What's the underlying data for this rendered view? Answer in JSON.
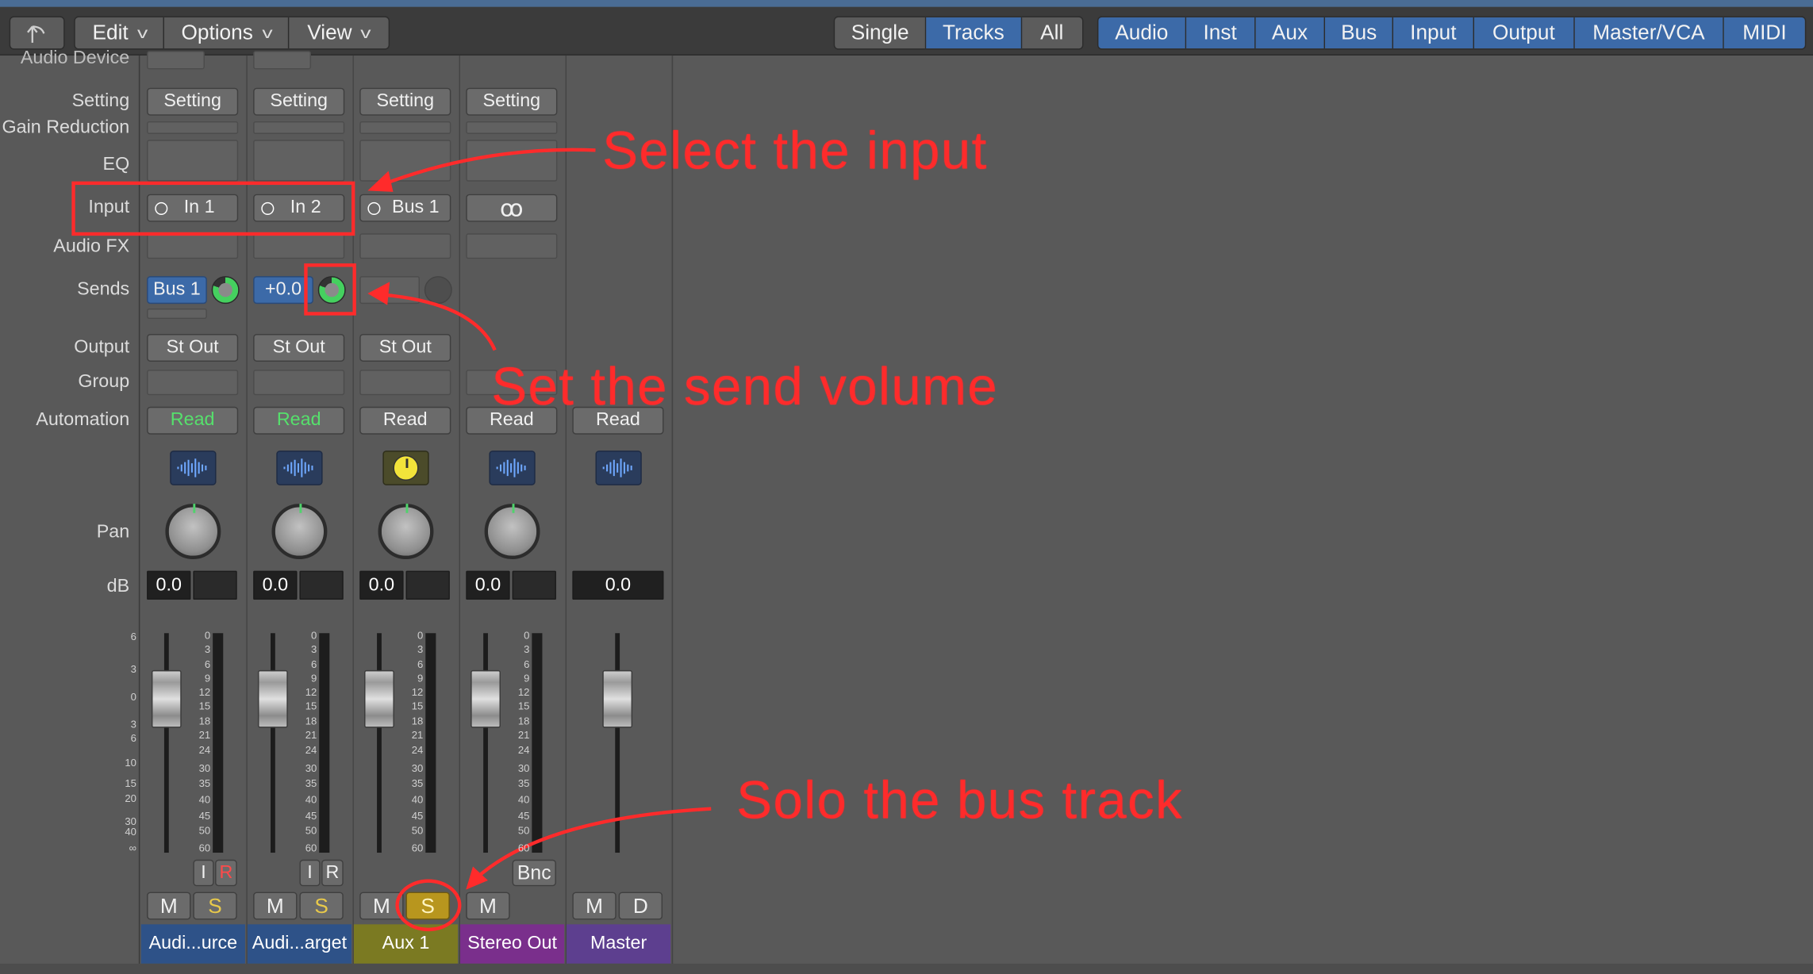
{
  "toolbar": {
    "menus": [
      "Edit",
      "Options",
      "View"
    ],
    "view_modes": [
      "Single",
      "Tracks",
      "All"
    ],
    "selected_view": "Tracks",
    "filters": [
      "Audio",
      "Inst",
      "Aux",
      "Bus",
      "Input",
      "Output",
      "Master/VCA",
      "MIDI"
    ]
  },
  "row_labels": {
    "audio_device": "Audio Device",
    "setting": "Setting",
    "gain_reduction": "Gain Reduction",
    "eq": "EQ",
    "input": "Input",
    "audio_fx": "Audio FX",
    "sends": "Sends",
    "output": "Output",
    "group": "Group",
    "automation": "Automation",
    "pan": "Pan",
    "db": "dB"
  },
  "fader_scale": [
    "6",
    "3",
    "0",
    "3",
    "6",
    "10",
    "15",
    "20",
    "30",
    "40",
    "∞"
  ],
  "meter_scale": [
    "0",
    "3",
    "6",
    "9",
    "12",
    "15",
    "18",
    "21",
    "24",
    "30",
    "35",
    "40",
    "45",
    "50",
    "60"
  ],
  "strips": [
    {
      "name": "Audi...urce",
      "setting": "Setting",
      "input": "In 1",
      "send": "Bus 1",
      "output": "St Out",
      "automation": "Read",
      "db": "0.0",
      "i_label": "I",
      "r_label": "R",
      "mute": "M",
      "solo": "S"
    },
    {
      "name": "Audi...arget",
      "setting": "Setting",
      "input": "In 2",
      "send": "+0.0",
      "output": "St Out",
      "automation": "Read",
      "db": "0.0",
      "i_label": "I",
      "r_label": "R",
      "mute": "M",
      "solo": "S"
    },
    {
      "name": "Aux 1",
      "setting": "Setting",
      "input": "Bus 1",
      "output": "St Out",
      "automation": "Read",
      "db": "0.0",
      "mute": "M",
      "solo": "S"
    },
    {
      "name": "Stereo Out",
      "setting": "Setting",
      "input_symbol": "ꝏ",
      "automation": "Read",
      "db": "0.0",
      "bnc_label": "Bnc",
      "mute": "M"
    },
    {
      "name": "Master",
      "automation": "Read",
      "db": "0.0",
      "mute": "M",
      "dim": "D"
    }
  ],
  "annotations": {
    "select_input": "Select the input",
    "send_volume": "Set the send volume",
    "solo_bus": "Solo the bus track"
  },
  "colors": {
    "accent_blue": "#3c6aa8",
    "annotation_red": "#ff2b2b",
    "read_green": "#56e06c",
    "solo_yellow": "#e8c94a",
    "strip_blue": "#2e5288",
    "strip_olive": "#7b7a22",
    "strip_purple": "#7a2f8c",
    "strip_violet": "#5d3f8f"
  },
  "icons": [
    "back-arrow-icon",
    "waveform-icon",
    "aux-dial-icon",
    "pan-knob-icon",
    "send-knob-icon",
    "input-monitor-icon"
  ]
}
